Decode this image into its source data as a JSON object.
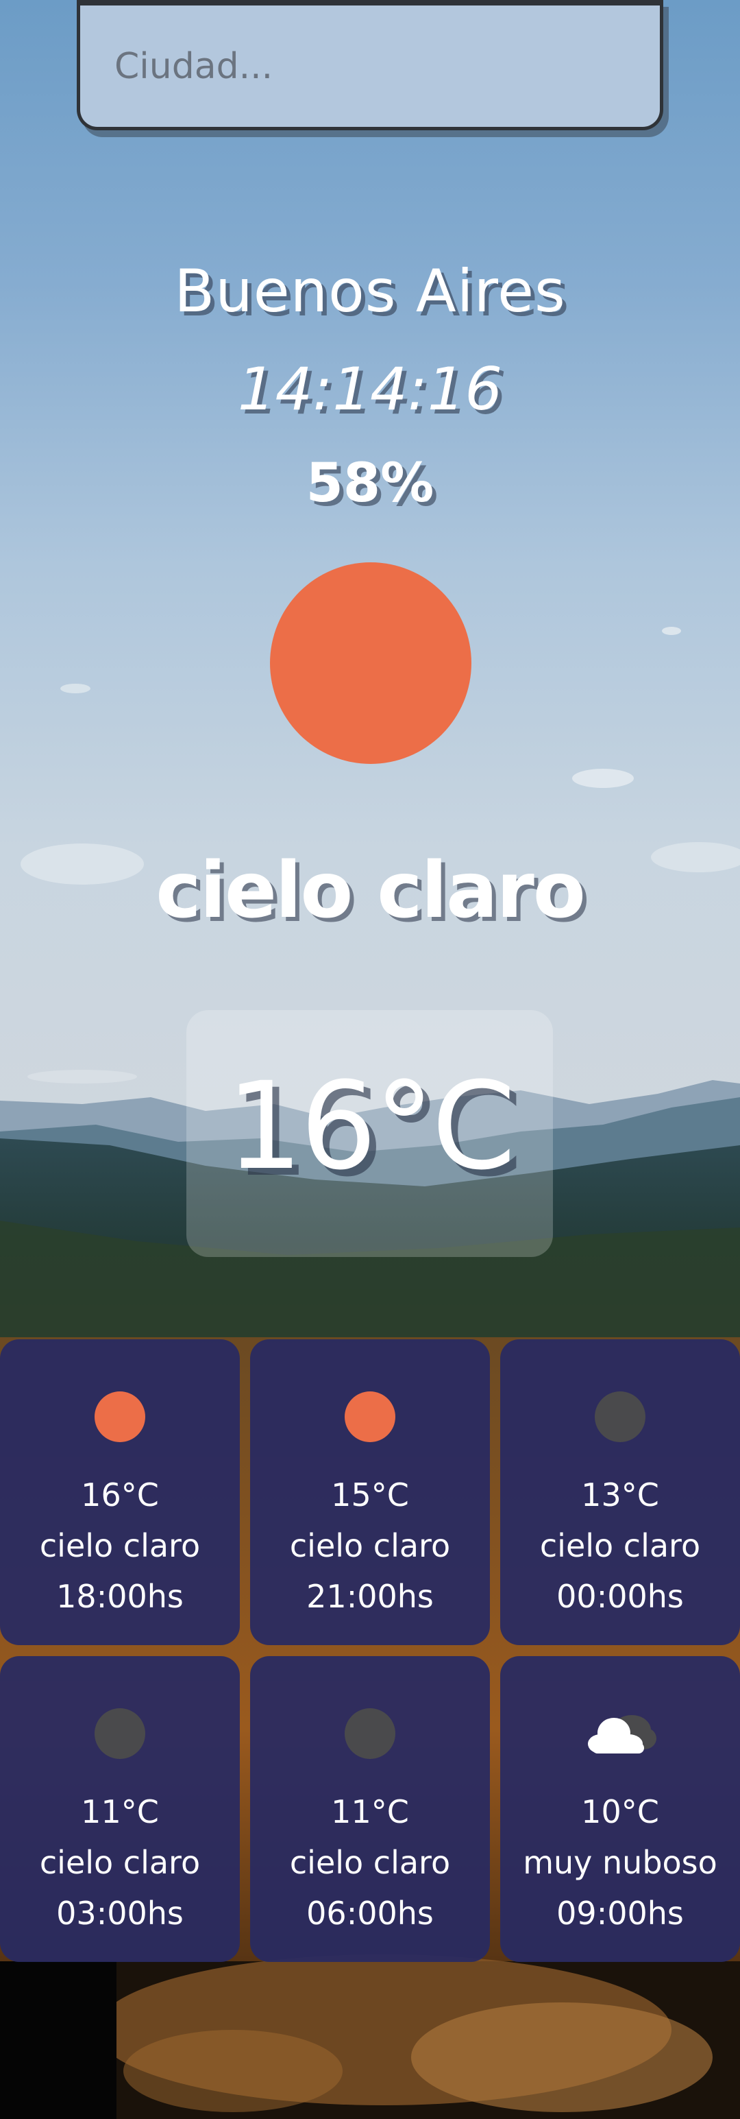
{
  "search": {
    "placeholder": "Ciudad..."
  },
  "current": {
    "city": "Buenos Aires",
    "time": "14:14:16",
    "humidity": "58%",
    "icon": "sun-icon",
    "description": "cielo claro",
    "temperature": "16°C"
  },
  "colors": {
    "sun": "#ec6e48",
    "moon": "#4a4a4c",
    "card_bg": "#28296a",
    "search_bg": "#b3c7dd"
  },
  "forecast": [
    {
      "temp": "16°C",
      "desc": "cielo claro",
      "hour": "18:00hs",
      "icon": "sun-icon"
    },
    {
      "temp": "15°C",
      "desc": "cielo claro",
      "hour": "21:00hs",
      "icon": "sun-icon"
    },
    {
      "temp": "13°C",
      "desc": "cielo claro",
      "hour": "00:00hs",
      "icon": "moon-icon"
    },
    {
      "temp": "11°C",
      "desc": "cielo claro",
      "hour": "03:00hs",
      "icon": "moon-icon"
    },
    {
      "temp": "11°C",
      "desc": "cielo claro",
      "hour": "06:00hs",
      "icon": "moon-icon"
    },
    {
      "temp": "10°C",
      "desc": "muy nuboso",
      "hour": "09:00hs",
      "icon": "cloud-icon"
    }
  ]
}
